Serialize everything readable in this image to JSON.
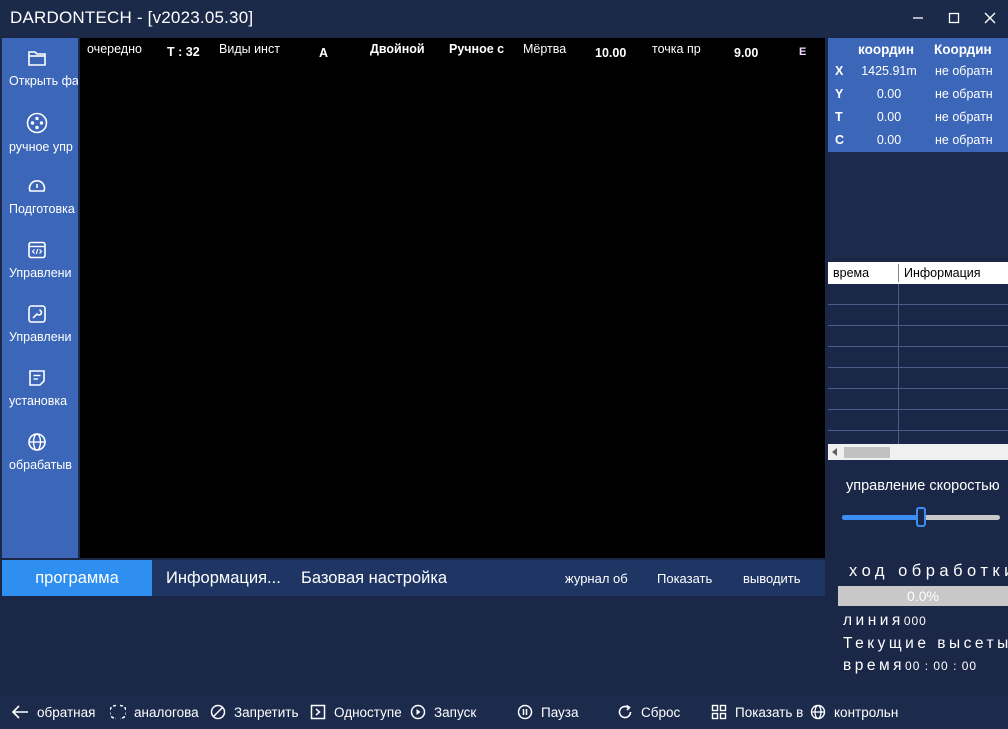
{
  "window": {
    "title": "DARDONTECH - [v2023.05.30]"
  },
  "sidebar": {
    "items": [
      {
        "label": "Открыть фа",
        "icon": "folder-icon"
      },
      {
        "label": "ручное упр",
        "icon": "joystick-icon"
      },
      {
        "label": "Подготовка",
        "icon": "gauge-icon"
      },
      {
        "label": "Управлени",
        "icon": "code-window-icon"
      },
      {
        "label": "Управлени",
        "icon": "wrench-icon"
      },
      {
        "label": "установка",
        "icon": "document-icon"
      },
      {
        "label": "обрабатыв",
        "icon": "globe-icon"
      }
    ]
  },
  "status": {
    "item1": "очередно",
    "item2": "T : 32",
    "item3": "Виды инст",
    "item4": "A",
    "item5": "Двойной",
    "item6": "Ручное с",
    "item7": "Мёртва",
    "item8": "10.00",
    "item9": "точка пр",
    "item10": "9.00",
    "item11": "E"
  },
  "coords": {
    "header_left": "координ",
    "header_right": "Координ",
    "rows": [
      {
        "axis": "X",
        "value": "1425.91m",
        "mech": "не обратн"
      },
      {
        "axis": "Y",
        "value": "0.00",
        "mech": "не обратн"
      },
      {
        "axis": "T",
        "value": "0.00",
        "mech": "не обратн"
      },
      {
        "axis": "C",
        "value": "0.00",
        "mech": "не обратн"
      }
    ]
  },
  "log": {
    "col_time": "врема",
    "col_info": "Информация"
  },
  "speed": {
    "label": "управление скоростью",
    "level": 0.5
  },
  "tabs": {
    "program": "программа",
    "info": "Информация...",
    "basic": "Базовая настройка",
    "log": "журнал об",
    "show": "Показать",
    "output": "выводить"
  },
  "progress": {
    "title": "ход обработки",
    "percent": "0.0%",
    "value": 0,
    "line_label": "линия",
    "line_value": "000",
    "height_label": "Текущие высеты",
    "time_label": "время",
    "time_value": "00 : 00 : 00"
  },
  "bottom": {
    "back": "обратная",
    "simulate": "аналогова",
    "disable": "Запретить",
    "step": "Одноступе",
    "start": "Запуск",
    "pause": "Пауза",
    "reset": "Сброс",
    "show": "Показать в",
    "control": "контрольн"
  },
  "colors": {
    "accent": "#2e8ff0",
    "sidebar": "#3c66b8",
    "background": "#1a2747"
  }
}
